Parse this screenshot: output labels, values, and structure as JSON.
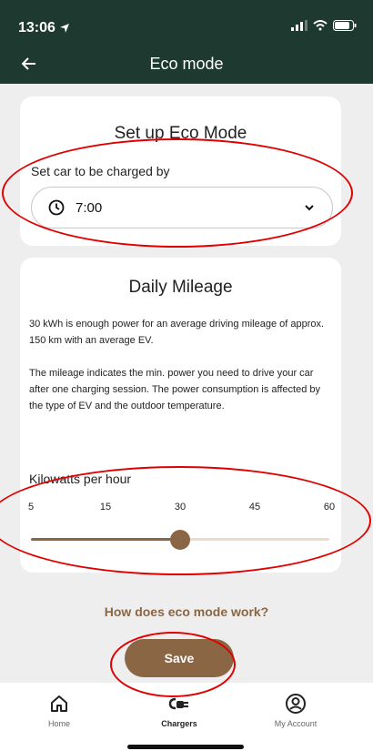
{
  "status_bar": {
    "time": "13:06"
  },
  "nav": {
    "title": "Eco mode"
  },
  "setup": {
    "title": "Set up Eco Mode",
    "label": "Set car to be charged by",
    "time_value": "7:00"
  },
  "mileage": {
    "title": "Daily Mileage",
    "paragraph1": "30 kWh is enough power for an average driving mileage of approx. 150 km with an average EV.",
    "paragraph2": "The mileage indicates the min. power you need to drive your car after one charging session. The power consumption is affected by the type of EV and the outdoor temperature.",
    "slider_label": "Kilowatts per hour",
    "ticks": [
      "5",
      "15",
      "30",
      "45",
      "60"
    ],
    "slider_fraction": 0.5
  },
  "how_link": "How does eco mode work?",
  "save_label": "Save",
  "bottom_nav": [
    {
      "label": "Home",
      "icon": "home-icon"
    },
    {
      "label": "Chargers",
      "icon": "charger-plug-icon"
    },
    {
      "label": "My Account",
      "icon": "account-icon"
    }
  ],
  "colors": {
    "header": "#1e3a30",
    "accent": "#8a6644",
    "annotation": "#e00000"
  }
}
